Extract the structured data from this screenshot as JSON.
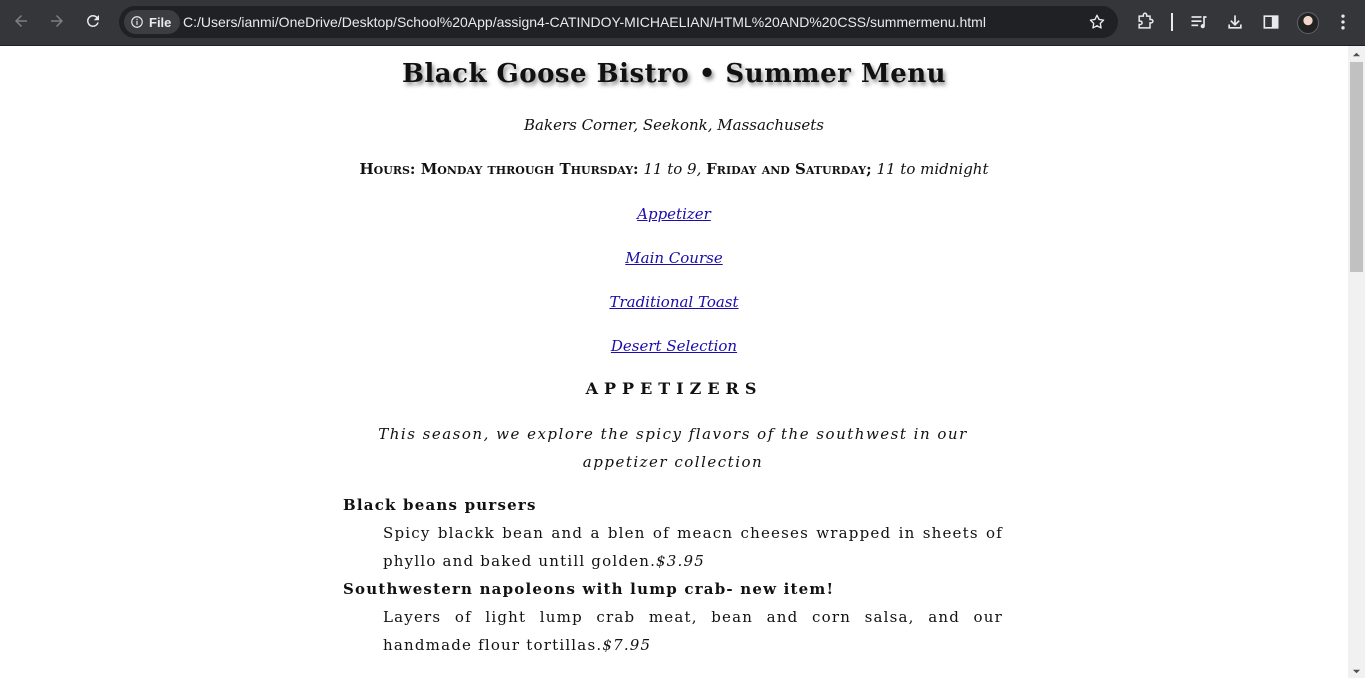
{
  "browser": {
    "chip_label": "File",
    "url": "C:/Users/ianmi/OneDrive/Desktop/School%20App/assign4-CATINDOY-MICHAELIAN/HTML%20AND%20CSS/summermenu.html"
  },
  "page": {
    "title": "Black Goose Bistro • Summer Menu",
    "address": "Bakers Corner, Seekonk, Massachusets",
    "hours": {
      "label1": "Hours: Monday through Thursday:",
      "time1": "11 to 9,",
      "label2": "Friday and Saturday;",
      "time2": "11 to midnight"
    },
    "nav_links": [
      "Appetizer",
      "Main Course",
      "Traditional Toast",
      "Desert Selection"
    ],
    "section_heading": "APPETIZERS",
    "intro": "This season, we explore the spicy flavors of the southwest in our appetizer collection",
    "dishes": [
      {
        "name": "Black beans pursers",
        "description": "Spicy blackk bean and a blen of meacn cheeses wrapped in sheets of phyllo and baked untill golden.",
        "price": "$3.95"
      },
      {
        "name": "Southwestern napoleons with lump crab- new item!",
        "description": "Layers of light lump crab meat, bean and corn salsa, and our handmade flour tortillas.",
        "price": "$7.95"
      }
    ]
  }
}
